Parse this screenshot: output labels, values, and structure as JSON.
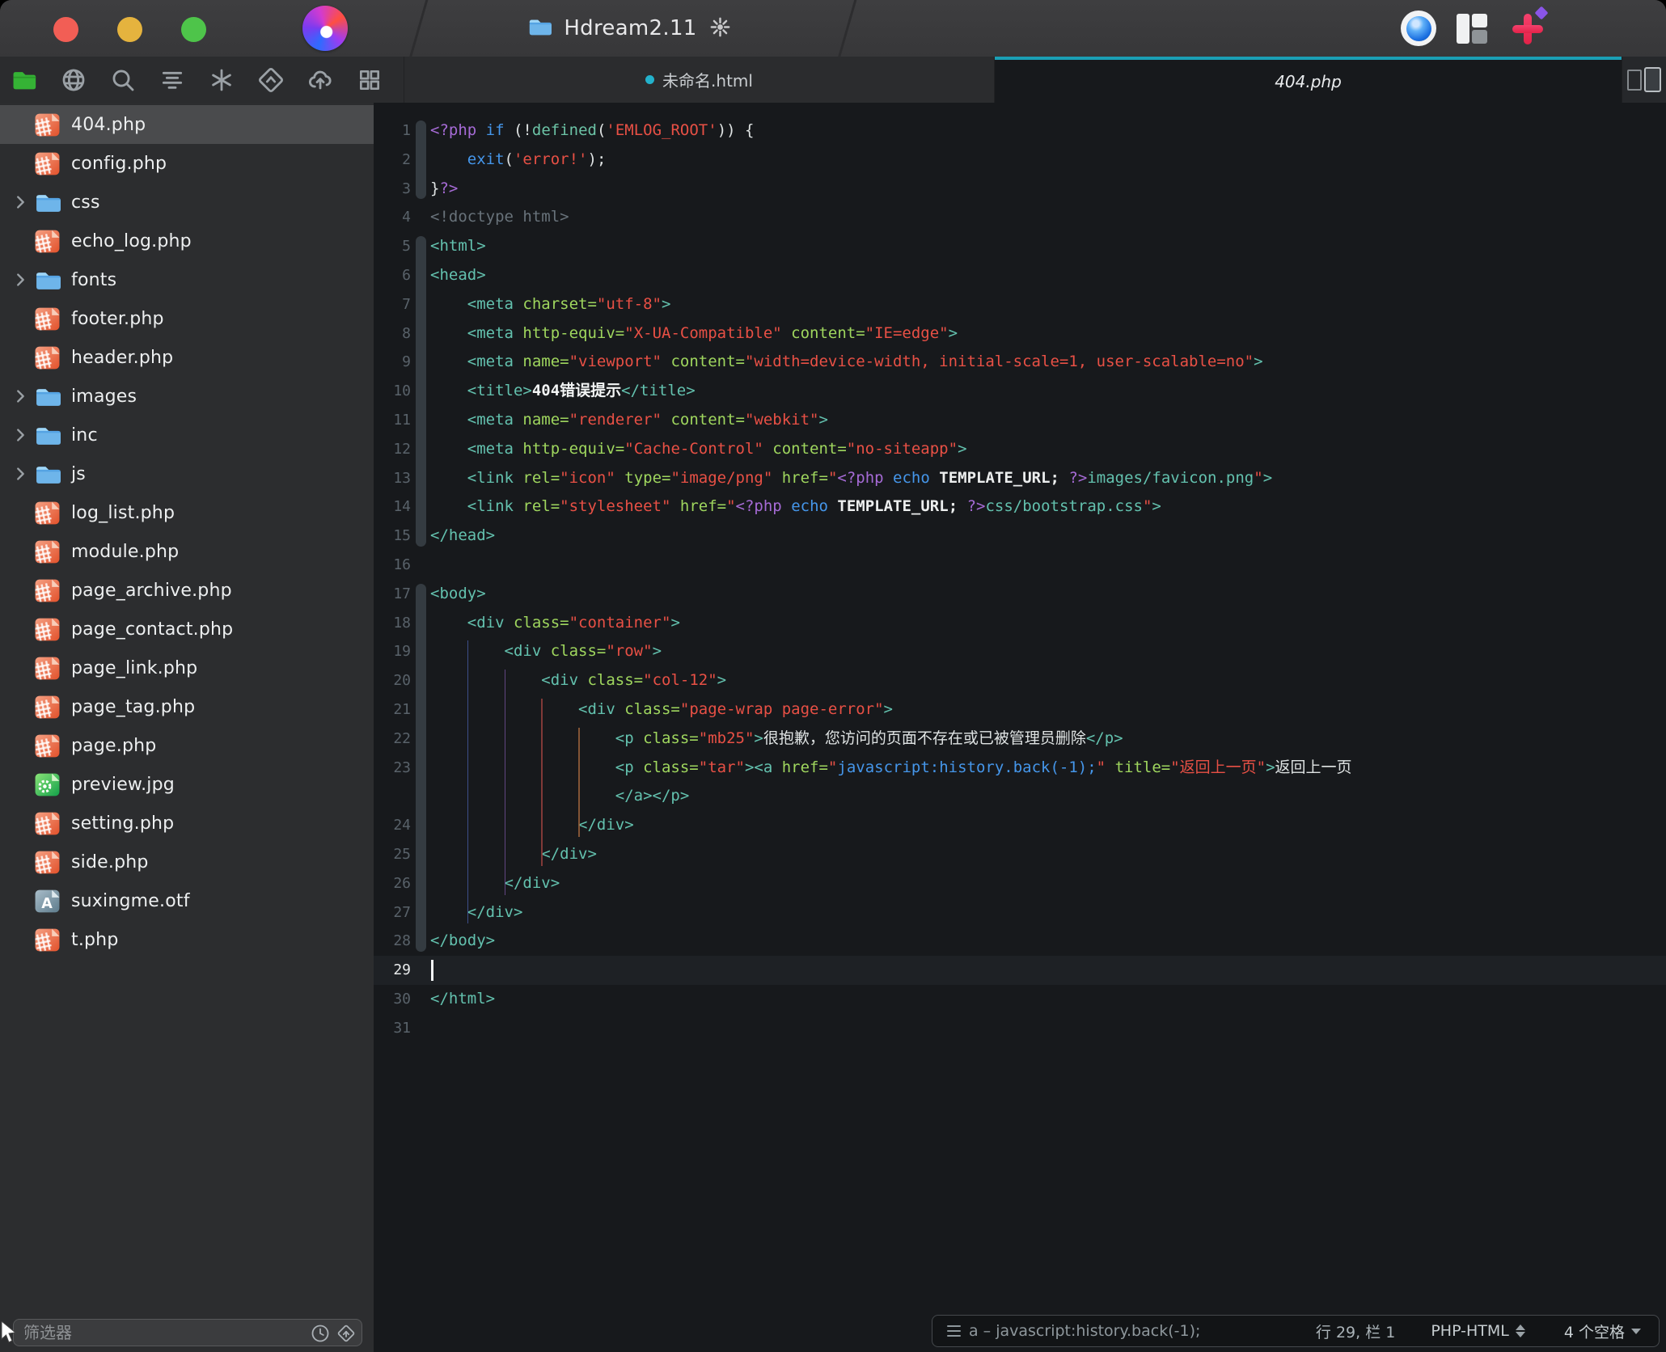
{
  "window": {
    "project_name": "Hdream2.11"
  },
  "titlebar": {
    "traffic_lights": [
      "close",
      "minimize",
      "zoom"
    ],
    "right_icons": [
      "preview-eye-icon",
      "layout-panes-icon",
      "add-plus-icon"
    ]
  },
  "toolbar": {
    "icons": [
      {
        "name": "files-folder",
        "active": true
      },
      {
        "name": "globe",
        "active": false
      },
      {
        "name": "search",
        "active": false
      },
      {
        "name": "text-lines",
        "active": false
      },
      {
        "name": "asterisk",
        "active": false
      },
      {
        "name": "diamond-up",
        "active": false
      },
      {
        "name": "cloud-upload",
        "active": false
      },
      {
        "name": "grid",
        "active": false
      }
    ]
  },
  "tabs": [
    {
      "label": "未命名.html",
      "modified": true,
      "active": false
    },
    {
      "label": "404.php",
      "modified": false,
      "active": true
    }
  ],
  "sidebar": {
    "filter_placeholder": "筛选器",
    "items": [
      {
        "label": "404.php",
        "kind": "php",
        "selected": true,
        "expandable": false
      },
      {
        "label": "config.php",
        "kind": "php",
        "selected": false,
        "expandable": false
      },
      {
        "label": "css",
        "kind": "folder",
        "selected": false,
        "expandable": true
      },
      {
        "label": "echo_log.php",
        "kind": "php",
        "selected": false,
        "expandable": false
      },
      {
        "label": "fonts",
        "kind": "folder",
        "selected": false,
        "expandable": true
      },
      {
        "label": "footer.php",
        "kind": "php",
        "selected": false,
        "expandable": false
      },
      {
        "label": "header.php",
        "kind": "php",
        "selected": false,
        "expandable": false
      },
      {
        "label": "images",
        "kind": "folder",
        "selected": false,
        "expandable": true
      },
      {
        "label": "inc",
        "kind": "folder",
        "selected": false,
        "expandable": true
      },
      {
        "label": "js",
        "kind": "folder",
        "selected": false,
        "expandable": true
      },
      {
        "label": "log_list.php",
        "kind": "php",
        "selected": false,
        "expandable": false
      },
      {
        "label": "module.php",
        "kind": "php",
        "selected": false,
        "expandable": false
      },
      {
        "label": "page_archive.php",
        "kind": "php",
        "selected": false,
        "expandable": false
      },
      {
        "label": "page_contact.php",
        "kind": "php",
        "selected": false,
        "expandable": false
      },
      {
        "label": "page_link.php",
        "kind": "php",
        "selected": false,
        "expandable": false
      },
      {
        "label": "page_tag.php",
        "kind": "php",
        "selected": false,
        "expandable": false
      },
      {
        "label": "page.php",
        "kind": "php",
        "selected": false,
        "expandable": false
      },
      {
        "label": "preview.jpg",
        "kind": "image",
        "selected": false,
        "expandable": false
      },
      {
        "label": "setting.php",
        "kind": "php",
        "selected": false,
        "expandable": false
      },
      {
        "label": "side.php",
        "kind": "php",
        "selected": false,
        "expandable": false
      },
      {
        "label": "suxingme.otf",
        "kind": "font",
        "selected": false,
        "expandable": false
      },
      {
        "label": "t.php",
        "kind": "php",
        "selected": false,
        "expandable": false
      }
    ]
  },
  "editor": {
    "current_line": 29,
    "folds": [
      {
        "from": 1,
        "to": 3
      },
      {
        "from": 5,
        "to": 15
      },
      {
        "from": 17,
        "to": 29
      }
    ],
    "guides": [
      {
        "col": 4,
        "from": 19,
        "to": 28,
        "c": "#44589e"
      },
      {
        "col": 8,
        "from": 20,
        "to": 27,
        "c": "#6f4d93"
      },
      {
        "col": 12,
        "from": 21,
        "to": 26,
        "c": "#93403c"
      },
      {
        "col": 16,
        "from": 22,
        "to": 25,
        "c": "#96603a"
      }
    ],
    "lines": [
      {
        "n": 1,
        "segs": [
          [
            "php",
            "<?php"
          ],
          [
            "pl",
            " "
          ],
          [
            "kw",
            "if"
          ],
          [
            "pl",
            " (!"
          ],
          [
            "fn",
            "defined"
          ],
          [
            "pl",
            "("
          ],
          [
            "str",
            "'EMLOG_ROOT'"
          ],
          [
            "pl",
            ")) {"
          ]
        ]
      },
      {
        "n": 2,
        "segs": [
          [
            "pl",
            "    "
          ],
          [
            "kw",
            "exit"
          ],
          [
            "pl",
            "("
          ],
          [
            "str",
            "'error!'"
          ],
          [
            "pl",
            ");"
          ]
        ]
      },
      {
        "n": 3,
        "segs": [
          [
            "pl",
            "}"
          ],
          [
            "php",
            "?>"
          ]
        ]
      },
      {
        "n": 4,
        "segs": [
          [
            "cm",
            "<!doctype html>"
          ]
        ]
      },
      {
        "n": 5,
        "segs": [
          [
            "tag",
            "<html>"
          ]
        ]
      },
      {
        "n": 6,
        "segs": [
          [
            "tag",
            "<head>"
          ]
        ]
      },
      {
        "n": 7,
        "segs": [
          [
            "pl",
            "    "
          ],
          [
            "tag",
            "<meta"
          ],
          [
            "attr",
            " charset="
          ],
          [
            "str",
            "\"utf-8\""
          ],
          [
            "tag",
            ">"
          ]
        ]
      },
      {
        "n": 8,
        "segs": [
          [
            "pl",
            "    "
          ],
          [
            "tag",
            "<meta"
          ],
          [
            "attr",
            " http-equiv="
          ],
          [
            "str",
            "\"X-UA-Compatible\""
          ],
          [
            "attr",
            " content="
          ],
          [
            "str",
            "\"IE=edge\""
          ],
          [
            "tag",
            ">"
          ]
        ]
      },
      {
        "n": 9,
        "segs": [
          [
            "pl",
            "    "
          ],
          [
            "tag",
            "<meta"
          ],
          [
            "attr",
            " name="
          ],
          [
            "str",
            "\"viewport\""
          ],
          [
            "attr",
            " content="
          ],
          [
            "str",
            "\"width=device-width, initial-scale=1, user-scalable=no\""
          ],
          [
            "tag",
            ">"
          ]
        ]
      },
      {
        "n": 10,
        "segs": [
          [
            "pl",
            "    "
          ],
          [
            "tag",
            "<title>"
          ],
          [
            "b",
            "404错误提示"
          ],
          [
            "tag",
            "</title>"
          ]
        ]
      },
      {
        "n": 11,
        "segs": [
          [
            "pl",
            "    "
          ],
          [
            "tag",
            "<meta"
          ],
          [
            "attr",
            " name="
          ],
          [
            "str",
            "\"renderer\""
          ],
          [
            "attr",
            " content="
          ],
          [
            "str",
            "\"webkit\""
          ],
          [
            "tag",
            ">"
          ]
        ]
      },
      {
        "n": 12,
        "segs": [
          [
            "pl",
            "    "
          ],
          [
            "tag",
            "<meta"
          ],
          [
            "attr",
            " http-equiv="
          ],
          [
            "str",
            "\"Cache-Control\""
          ],
          [
            "attr",
            " content="
          ],
          [
            "str",
            "\"no-siteapp\""
          ],
          [
            "tag",
            ">"
          ]
        ]
      },
      {
        "n": 13,
        "segs": [
          [
            "pl",
            "    "
          ],
          [
            "tag",
            "<link"
          ],
          [
            "attr",
            " rel="
          ],
          [
            "str",
            "\"icon\""
          ],
          [
            "attr",
            " type="
          ],
          [
            "str",
            "\"image/png\""
          ],
          [
            "attr",
            " href="
          ],
          [
            "str",
            "\""
          ],
          [
            "php",
            "<?php"
          ],
          [
            "pl",
            " "
          ],
          [
            "kw",
            "echo"
          ],
          [
            "pl",
            " "
          ],
          [
            "cn",
            "TEMPLATE_URL;"
          ],
          [
            "pl",
            " "
          ],
          [
            "php",
            "?>"
          ],
          [
            "tag",
            "images/favicon.png"
          ],
          [
            "str",
            "\""
          ],
          [
            "tag",
            ">"
          ]
        ]
      },
      {
        "n": 14,
        "segs": [
          [
            "pl",
            "    "
          ],
          [
            "tag",
            "<link"
          ],
          [
            "attr",
            " rel="
          ],
          [
            "str",
            "\"stylesheet\""
          ],
          [
            "attr",
            " href="
          ],
          [
            "str",
            "\""
          ],
          [
            "php",
            "<?php"
          ],
          [
            "pl",
            " "
          ],
          [
            "kw",
            "echo"
          ],
          [
            "pl",
            " "
          ],
          [
            "cn",
            "TEMPLATE_URL;"
          ],
          [
            "pl",
            " "
          ],
          [
            "php",
            "?>"
          ],
          [
            "tag",
            "css/bootstrap.css"
          ],
          [
            "str",
            "\""
          ],
          [
            "tag",
            ">"
          ]
        ]
      },
      {
        "n": 15,
        "segs": [
          [
            "tag",
            "</head>"
          ]
        ]
      },
      {
        "n": 16,
        "segs": []
      },
      {
        "n": 17,
        "segs": [
          [
            "tag",
            "<body>"
          ]
        ]
      },
      {
        "n": 18,
        "segs": [
          [
            "pl",
            "    "
          ],
          [
            "tag",
            "<div"
          ],
          [
            "attr",
            " class="
          ],
          [
            "str",
            "\"container\""
          ],
          [
            "tag",
            ">"
          ]
        ]
      },
      {
        "n": 19,
        "segs": [
          [
            "pl",
            "        "
          ],
          [
            "tag",
            "<div"
          ],
          [
            "attr",
            " class="
          ],
          [
            "str",
            "\"row\""
          ],
          [
            "tag",
            ">"
          ]
        ]
      },
      {
        "n": 20,
        "segs": [
          [
            "pl",
            "            "
          ],
          [
            "tag",
            "<div"
          ],
          [
            "attr",
            " class="
          ],
          [
            "str",
            "\"col-12\""
          ],
          [
            "tag",
            ">"
          ]
        ]
      },
      {
        "n": 21,
        "segs": [
          [
            "pl",
            "                "
          ],
          [
            "tag",
            "<div"
          ],
          [
            "attr",
            " class="
          ],
          [
            "str",
            "\"page-wrap page-error\""
          ],
          [
            "tag",
            ">"
          ]
        ]
      },
      {
        "n": 22,
        "segs": [
          [
            "pl",
            "                    "
          ],
          [
            "tag",
            "<p"
          ],
          [
            "attr",
            " class="
          ],
          [
            "str",
            "\"mb25\""
          ],
          [
            "tag",
            ">"
          ],
          [
            "pl",
            "很抱歉，您访问的页面不存在或已被管理员删除"
          ],
          [
            "tag",
            "</p>"
          ]
        ]
      },
      {
        "n": 23,
        "segs": [
          [
            "pl",
            "                    "
          ],
          [
            "tag",
            "<p"
          ],
          [
            "attr",
            " class="
          ],
          [
            "str",
            "\"tar\""
          ],
          [
            "tag",
            "><a"
          ],
          [
            "attr",
            " href="
          ],
          [
            "str",
            "\""
          ],
          [
            "lk",
            "javascript:history.back(-1);"
          ],
          [
            "str",
            "\""
          ],
          [
            "attr",
            " title="
          ],
          [
            "str",
            "\"返回上一页\""
          ],
          [
            "tag",
            ">"
          ],
          [
            "pl",
            "返回上一页"
          ]
        ]
      },
      {
        "n": null,
        "segs": [
          [
            "pl",
            "                    "
          ],
          [
            "tag",
            "</a></p>"
          ]
        ]
      },
      {
        "n": 24,
        "segs": [
          [
            "pl",
            "                "
          ],
          [
            "tag",
            "</div>"
          ]
        ]
      },
      {
        "n": 25,
        "segs": [
          [
            "pl",
            "            "
          ],
          [
            "tag",
            "</div>"
          ]
        ]
      },
      {
        "n": 26,
        "segs": [
          [
            "pl",
            "        "
          ],
          [
            "tag",
            "</div>"
          ]
        ]
      },
      {
        "n": 27,
        "segs": [
          [
            "pl",
            "    "
          ],
          [
            "tag",
            "</div>"
          ]
        ]
      },
      {
        "n": 28,
        "segs": [
          [
            "tag",
            "</body>"
          ]
        ]
      },
      {
        "n": 29,
        "segs": [],
        "current": true
      },
      {
        "n": 30,
        "segs": [
          [
            "tag",
            "</html>"
          ]
        ]
      },
      {
        "n": 31,
        "segs": []
      }
    ]
  },
  "statusbar": {
    "context": "a – javascript:history.back(-1);",
    "line_col": "行 29, 栏 1",
    "mode": "PHP-HTML",
    "indent": "4 个空格"
  },
  "colors": {
    "accent_teal": "#1a9fb5",
    "modified_dot": "#23b2cc",
    "syntax": {
      "tag": "#63c1ae",
      "attr": "#9fd65e",
      "str": "#e85045",
      "php": "#a66bd6",
      "kw": "#4596ea",
      "fn": "#6cc3a6",
      "cn": "#eceeee",
      "cm": "#68727a",
      "lk": "#4596ea"
    },
    "php_icon": "#e2512b",
    "folder_icon": "#5aa7e6",
    "editor_bg": "#17191c",
    "sidebar_bg": "#2c2d2f"
  }
}
